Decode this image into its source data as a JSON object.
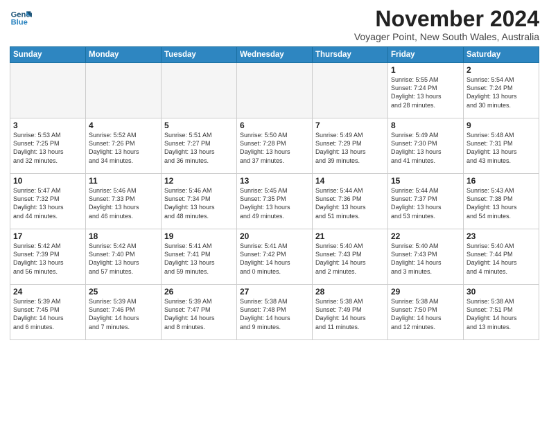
{
  "logo": {
    "line1": "General",
    "line2": "Blue"
  },
  "title": "November 2024",
  "subtitle": "Voyager Point, New South Wales, Australia",
  "days_of_week": [
    "Sunday",
    "Monday",
    "Tuesday",
    "Wednesday",
    "Thursday",
    "Friday",
    "Saturday"
  ],
  "weeks": [
    [
      {
        "day": "",
        "info": ""
      },
      {
        "day": "",
        "info": ""
      },
      {
        "day": "",
        "info": ""
      },
      {
        "day": "",
        "info": ""
      },
      {
        "day": "",
        "info": ""
      },
      {
        "day": "1",
        "info": "Sunrise: 5:55 AM\nSunset: 7:24 PM\nDaylight: 13 hours\nand 28 minutes."
      },
      {
        "day": "2",
        "info": "Sunrise: 5:54 AM\nSunset: 7:24 PM\nDaylight: 13 hours\nand 30 minutes."
      }
    ],
    [
      {
        "day": "3",
        "info": "Sunrise: 5:53 AM\nSunset: 7:25 PM\nDaylight: 13 hours\nand 32 minutes."
      },
      {
        "day": "4",
        "info": "Sunrise: 5:52 AM\nSunset: 7:26 PM\nDaylight: 13 hours\nand 34 minutes."
      },
      {
        "day": "5",
        "info": "Sunrise: 5:51 AM\nSunset: 7:27 PM\nDaylight: 13 hours\nand 36 minutes."
      },
      {
        "day": "6",
        "info": "Sunrise: 5:50 AM\nSunset: 7:28 PM\nDaylight: 13 hours\nand 37 minutes."
      },
      {
        "day": "7",
        "info": "Sunrise: 5:49 AM\nSunset: 7:29 PM\nDaylight: 13 hours\nand 39 minutes."
      },
      {
        "day": "8",
        "info": "Sunrise: 5:49 AM\nSunset: 7:30 PM\nDaylight: 13 hours\nand 41 minutes."
      },
      {
        "day": "9",
        "info": "Sunrise: 5:48 AM\nSunset: 7:31 PM\nDaylight: 13 hours\nand 43 minutes."
      }
    ],
    [
      {
        "day": "10",
        "info": "Sunrise: 5:47 AM\nSunset: 7:32 PM\nDaylight: 13 hours\nand 44 minutes."
      },
      {
        "day": "11",
        "info": "Sunrise: 5:46 AM\nSunset: 7:33 PM\nDaylight: 13 hours\nand 46 minutes."
      },
      {
        "day": "12",
        "info": "Sunrise: 5:46 AM\nSunset: 7:34 PM\nDaylight: 13 hours\nand 48 minutes."
      },
      {
        "day": "13",
        "info": "Sunrise: 5:45 AM\nSunset: 7:35 PM\nDaylight: 13 hours\nand 49 minutes."
      },
      {
        "day": "14",
        "info": "Sunrise: 5:44 AM\nSunset: 7:36 PM\nDaylight: 13 hours\nand 51 minutes."
      },
      {
        "day": "15",
        "info": "Sunrise: 5:44 AM\nSunset: 7:37 PM\nDaylight: 13 hours\nand 53 minutes."
      },
      {
        "day": "16",
        "info": "Sunrise: 5:43 AM\nSunset: 7:38 PM\nDaylight: 13 hours\nand 54 minutes."
      }
    ],
    [
      {
        "day": "17",
        "info": "Sunrise: 5:42 AM\nSunset: 7:39 PM\nDaylight: 13 hours\nand 56 minutes."
      },
      {
        "day": "18",
        "info": "Sunrise: 5:42 AM\nSunset: 7:40 PM\nDaylight: 13 hours\nand 57 minutes."
      },
      {
        "day": "19",
        "info": "Sunrise: 5:41 AM\nSunset: 7:41 PM\nDaylight: 13 hours\nand 59 minutes."
      },
      {
        "day": "20",
        "info": "Sunrise: 5:41 AM\nSunset: 7:42 PM\nDaylight: 14 hours\nand 0 minutes."
      },
      {
        "day": "21",
        "info": "Sunrise: 5:40 AM\nSunset: 7:43 PM\nDaylight: 14 hours\nand 2 minutes."
      },
      {
        "day": "22",
        "info": "Sunrise: 5:40 AM\nSunset: 7:43 PM\nDaylight: 14 hours\nand 3 minutes."
      },
      {
        "day": "23",
        "info": "Sunrise: 5:40 AM\nSunset: 7:44 PM\nDaylight: 14 hours\nand 4 minutes."
      }
    ],
    [
      {
        "day": "24",
        "info": "Sunrise: 5:39 AM\nSunset: 7:45 PM\nDaylight: 14 hours\nand 6 minutes."
      },
      {
        "day": "25",
        "info": "Sunrise: 5:39 AM\nSunset: 7:46 PM\nDaylight: 14 hours\nand 7 minutes."
      },
      {
        "day": "26",
        "info": "Sunrise: 5:39 AM\nSunset: 7:47 PM\nDaylight: 14 hours\nand 8 minutes."
      },
      {
        "day": "27",
        "info": "Sunrise: 5:38 AM\nSunset: 7:48 PM\nDaylight: 14 hours\nand 9 minutes."
      },
      {
        "day": "28",
        "info": "Sunrise: 5:38 AM\nSunset: 7:49 PM\nDaylight: 14 hours\nand 11 minutes."
      },
      {
        "day": "29",
        "info": "Sunrise: 5:38 AM\nSunset: 7:50 PM\nDaylight: 14 hours\nand 12 minutes."
      },
      {
        "day": "30",
        "info": "Sunrise: 5:38 AM\nSunset: 7:51 PM\nDaylight: 14 hours\nand 13 minutes."
      }
    ]
  ]
}
